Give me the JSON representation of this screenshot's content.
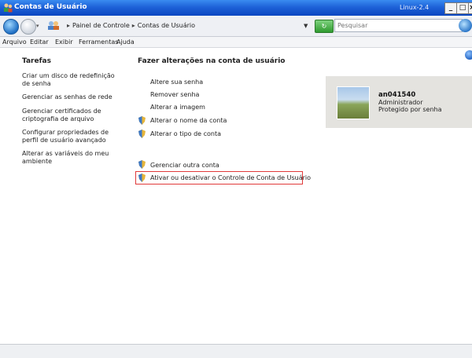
{
  "window": {
    "title": "Contas de Usuário",
    "host_label": "Linux-2.4",
    "minimize": "_",
    "maximize": "□",
    "close": "×"
  },
  "address": {
    "nav_dropdown": "▾",
    "breadcrumb": [
      "Painel de Controle",
      "Contas de Usuário"
    ],
    "breadcrumb_sep": "▸",
    "dropdown": "▼",
    "search_placeholder": "Pesquisar"
  },
  "menu": [
    "Arquivo",
    "Editar",
    "Exibir",
    "Ferramentas",
    "Ajuda"
  ],
  "tasks": {
    "title": "Tarefas",
    "items": [
      "Criar um disco de redefinição de senha",
      "Gerenciar as senhas de rede",
      "Gerenciar certificados de criptografia de arquivo",
      "Configurar propriedades de perfil de usuário avançado",
      "Alterar as variáveis do meu ambiente"
    ]
  },
  "main": {
    "heading": "Fazer alterações na conta de usuário",
    "actions": [
      "Altere sua senha",
      "Remover senha",
      "Alterar a imagem",
      "Alterar o nome da conta",
      "Alterar o tipo de conta"
    ],
    "other_actions": [
      "Gerenciar outra conta",
      "Ativar ou desativar o Controle de Conta de Usuário"
    ]
  },
  "user": {
    "name": "an041540",
    "role": "Administrador",
    "protection": "Protegido por senha"
  },
  "colors": {
    "titlebar": "#1e62d8",
    "highlight_border": "#e03a3a"
  }
}
